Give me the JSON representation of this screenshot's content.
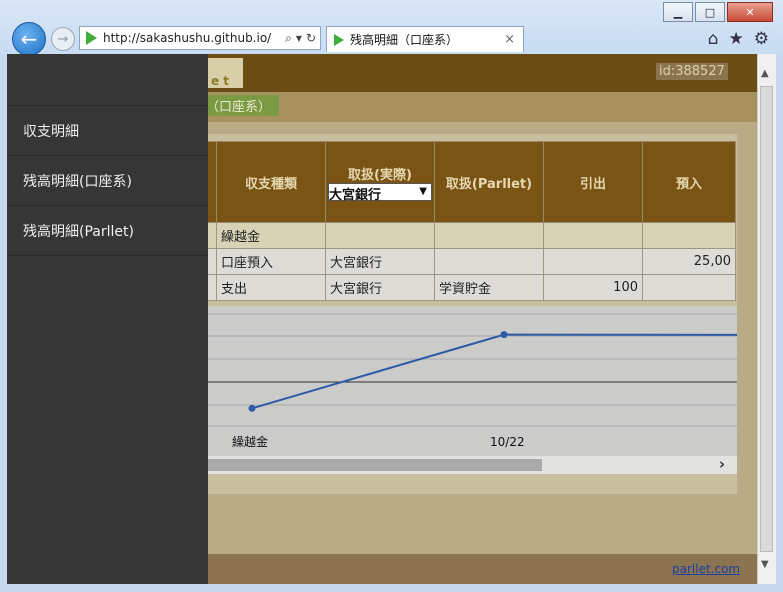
{
  "browser": {
    "url": "http://sakashushu.github.io/",
    "tab_title": "残高明細（口座系）",
    "tab_close": "×",
    "back_glyph": "←",
    "forward_glyph": "→",
    "icons": [
      "home-icon",
      "star-icon",
      "gear-icon"
    ],
    "window_buttons": {
      "minimize": "▁",
      "maximize": "□",
      "close": "✕"
    }
  },
  "header": {
    "logo_text": "e t",
    "id_label": "id:388527"
  },
  "breadcrumb": "（口座系）",
  "drawer": {
    "items": [
      "収支明細",
      "残高明細(口座系)",
      "残高明細(Parllet)"
    ]
  },
  "table": {
    "headers": {
      "type": "収支種類",
      "handling_actual": "取扱(実際)",
      "handling_select_value": "大宮銀行",
      "handling_parllet": "取扱(Parllet)",
      "withdrawal": "引出",
      "deposit": "預入"
    },
    "rows": [
      {
        "type": "繰越金",
        "actual": "",
        "parllet": "",
        "withdrawal": "",
        "deposit": ""
      },
      {
        "type": "口座預入",
        "actual": "大宮銀行",
        "parllet": "",
        "withdrawal": "",
        "deposit": "25,00"
      },
      {
        "type": "支出",
        "actual": "大宮銀行",
        "parllet": "学資貯金",
        "withdrawal": "100",
        "deposit": ""
      }
    ]
  },
  "chart_data": {
    "type": "line",
    "categories": [
      "繰越金",
      "10/22",
      ""
    ],
    "series": [
      {
        "values": [
          0,
          25000,
          24900
        ]
      }
    ],
    "tick_labels": [
      "繰越金",
      "10/22"
    ],
    "grid": true,
    "line_color": "#2e5aa6"
  },
  "footer": {
    "link": "parllet.com"
  }
}
